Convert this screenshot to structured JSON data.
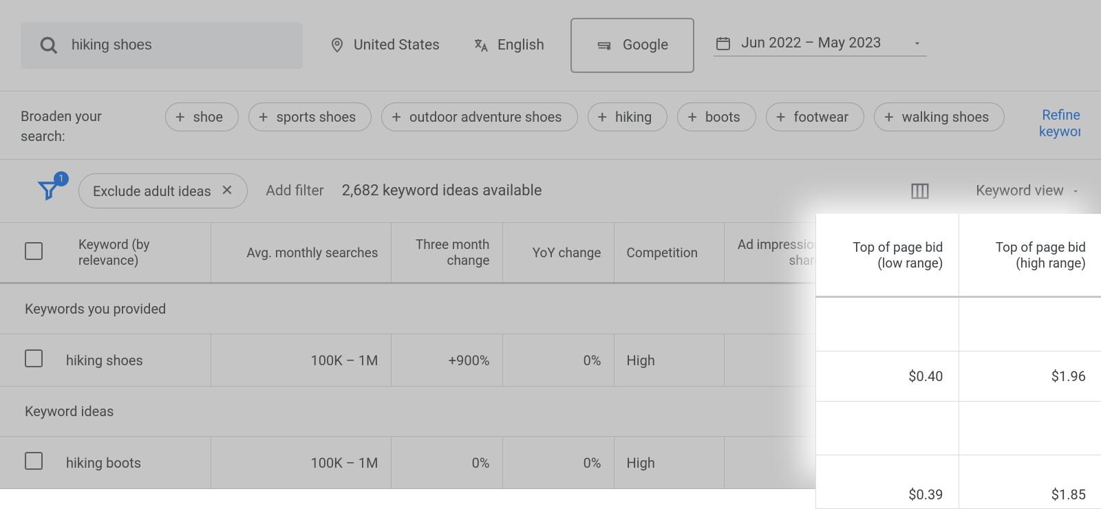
{
  "search": {
    "query": "hiking shoes"
  },
  "location": "United States",
  "language": "English",
  "network": "Google",
  "date_range": "Jun 2022 – May 2023",
  "broaden": {
    "label": "Broaden your search:",
    "chips": [
      "shoe",
      "sports shoes",
      "outdoor adventure shoes",
      "hiking",
      "boots",
      "footwear",
      "walking shoes"
    ]
  },
  "refine_link": "Refine keywords",
  "filters": {
    "badge": "1",
    "active": "Exclude adult ideas",
    "add": "Add filter",
    "count": "2,682 keyword ideas available",
    "view": "Keyword view"
  },
  "columns": {
    "keyword": "Keyword (by relevance)",
    "avg": "Avg. monthly searches",
    "three_month": "Three month change",
    "yoy": "YoY change",
    "competition": "Competition",
    "impression": "Ad impression share",
    "bid_low": "Top of page bid (low range)",
    "bid_high": "Top of page bid (high range)"
  },
  "sections": {
    "provided": "Keywords you provided",
    "ideas": "Keyword ideas"
  },
  "rows": [
    {
      "keyword": "hiking shoes",
      "avg": "100K – 1M",
      "three_month": "+900%",
      "yoy": "0%",
      "competition": "High",
      "bid_low": "$0.40",
      "bid_high": "$1.96"
    },
    {
      "keyword": "hiking boots",
      "avg": "100K – 1M",
      "three_month": "0%",
      "yoy": "0%",
      "competition": "High",
      "bid_low": "$0.39",
      "bid_high": "$1.85"
    }
  ]
}
